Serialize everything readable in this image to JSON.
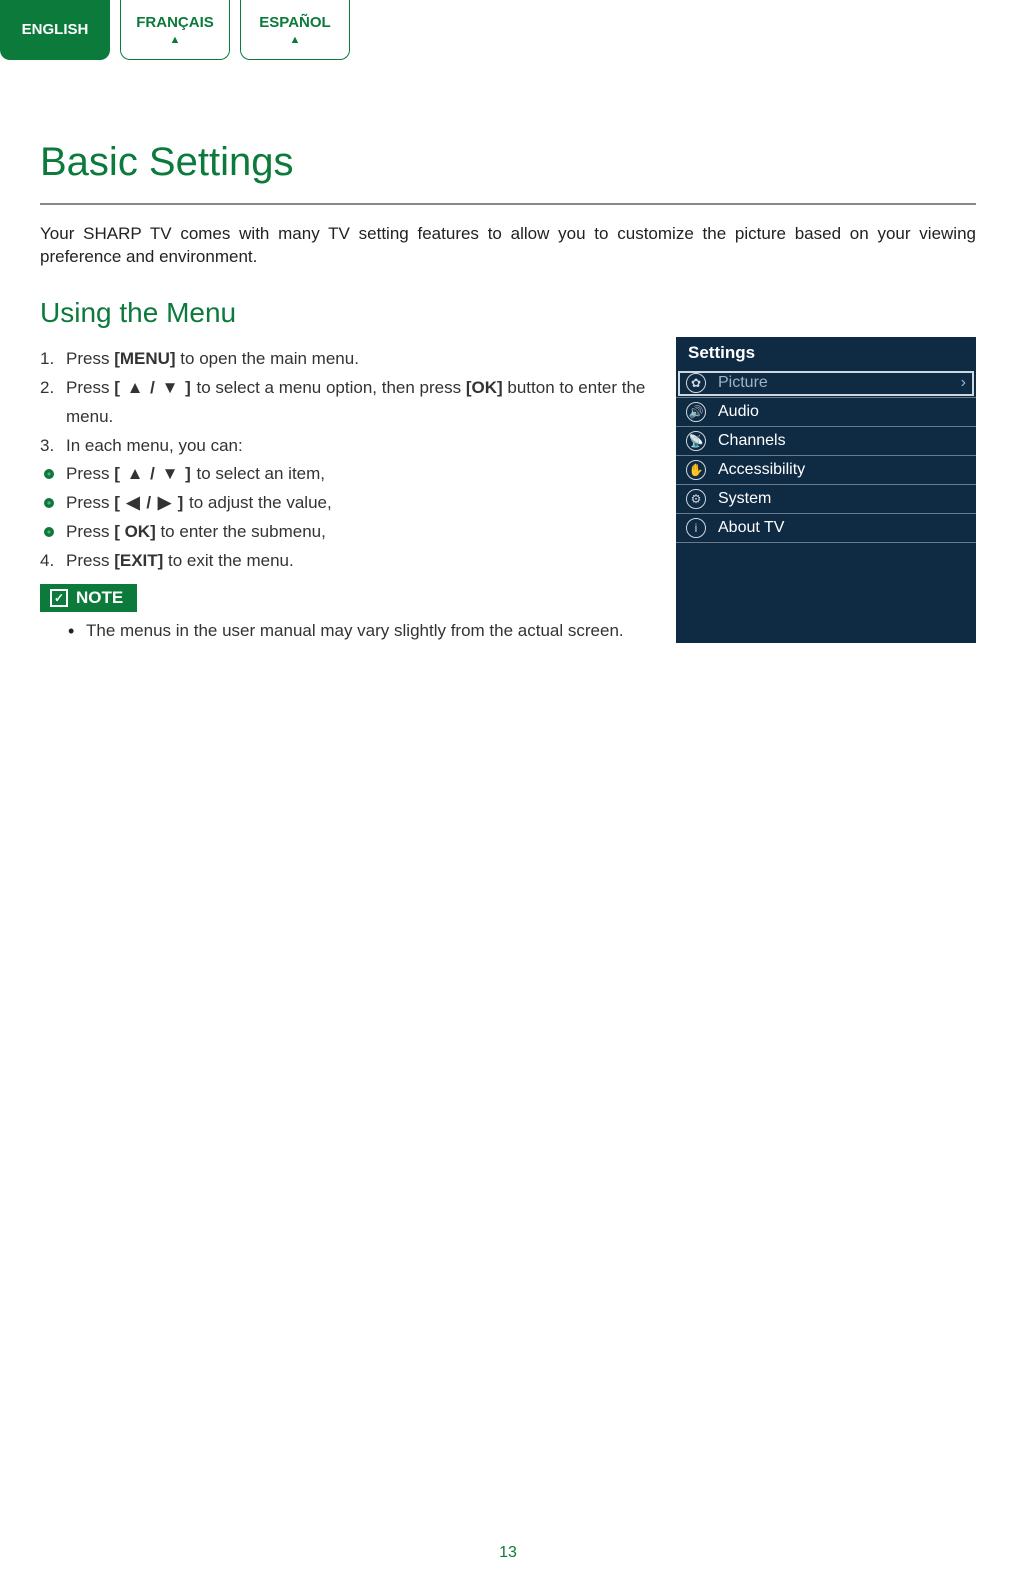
{
  "lang_tabs": {
    "english": "ENGLISH",
    "francais": "FRANÇAIS",
    "espanol": "ESPAÑOL"
  },
  "page_title": "Basic Settings",
  "intro": "Your SHARP TV comes with many TV setting features to allow you to customize the picture based on your viewing preference and environment.",
  "section_title": "Using the Menu",
  "steps": {
    "s1_a": "Press ",
    "s1_b": "[MENU]",
    "s1_c": " to open the main menu.",
    "s2_a": "Press ",
    "s2_b": "[ ▲ / ▼ ]",
    "s2_c": " to select a menu option, then press ",
    "s2_d": "[OK]",
    "s2_e": " button to enter the menu.",
    "s3": "In each menu, you can:",
    "sub1_a": "Press ",
    "sub1_b": "[ ▲ / ▼ ]",
    "sub1_c": " to select an item,",
    "sub2_a": "Press ",
    "sub2_b": "[ ◀ / ▶ ]",
    "sub2_c": " to adjust the value,",
    "sub3_a": "Press ",
    "sub3_b": "[ OK]",
    "sub3_c": " to enter the submenu,",
    "s4_a": "Press ",
    "s4_b": "[EXIT]",
    "s4_c": " to exit the menu."
  },
  "note_label": "NOTE",
  "note_text": "The menus in the user manual may vary slightly from the actual screen.",
  "settings_panel": {
    "title": "Settings",
    "items": [
      {
        "label": "Picture",
        "icon": "✿",
        "selected": true,
        "chev": "›"
      },
      {
        "label": "Audio",
        "icon": "🔊",
        "selected": false
      },
      {
        "label": "Channels",
        "icon": "📡",
        "selected": false
      },
      {
        "label": "Accessibility",
        "icon": "✋",
        "selected": false
      },
      {
        "label": "System",
        "icon": "⚙",
        "selected": false
      },
      {
        "label": "About TV",
        "icon": "i",
        "selected": false
      }
    ]
  },
  "page_number": "13"
}
